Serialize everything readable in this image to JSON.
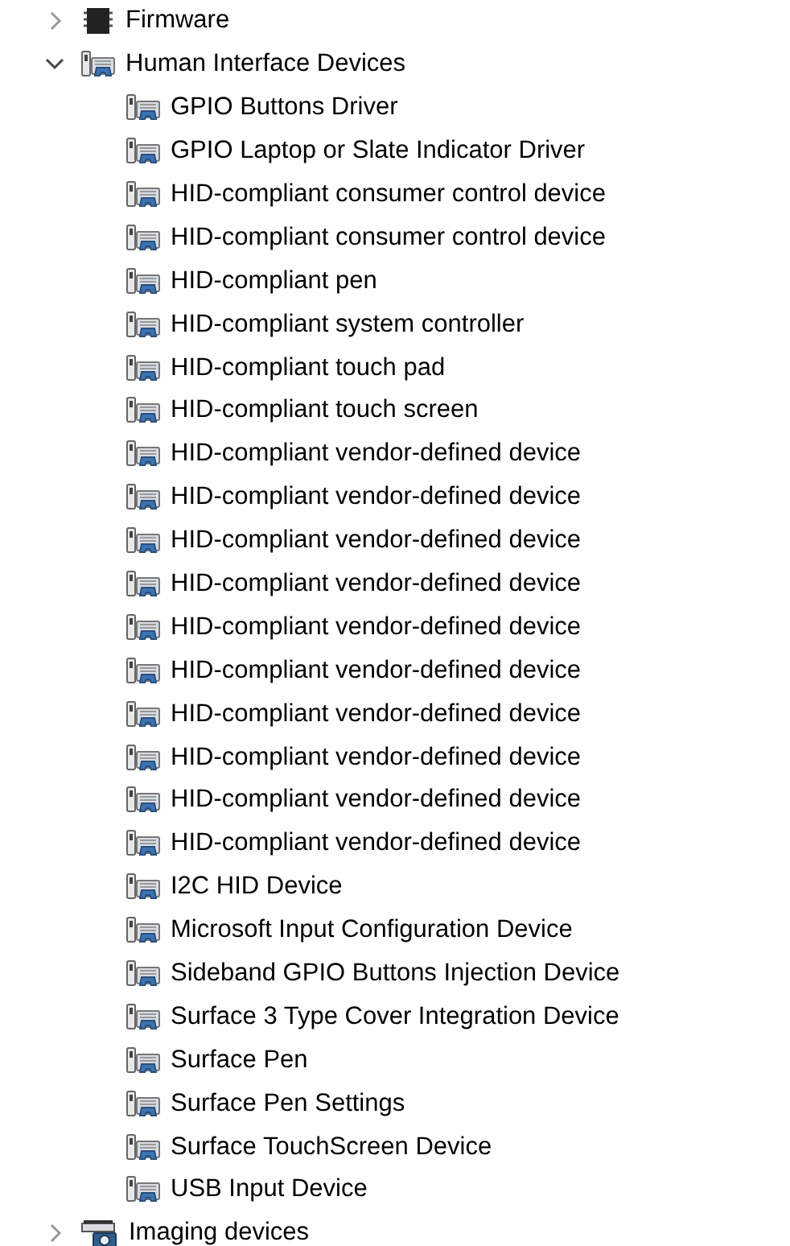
{
  "tree": [
    {
      "label": "Firmware",
      "kind": "firmware",
      "expanded": false
    },
    {
      "label": "Human Interface Devices",
      "kind": "hid",
      "expanded": true,
      "children": [
        {
          "label": "GPIO Buttons Driver"
        },
        {
          "label": "GPIO Laptop or Slate Indicator Driver"
        },
        {
          "label": "HID-compliant consumer control device"
        },
        {
          "label": "HID-compliant consumer control device"
        },
        {
          "label": "HID-compliant pen"
        },
        {
          "label": "HID-compliant system controller"
        },
        {
          "label": "HID-compliant touch pad"
        },
        {
          "label": "HID-compliant touch screen"
        },
        {
          "label": "HID-compliant vendor-defined device"
        },
        {
          "label": "HID-compliant vendor-defined device"
        },
        {
          "label": "HID-compliant vendor-defined device"
        },
        {
          "label": "HID-compliant vendor-defined device"
        },
        {
          "label": "HID-compliant vendor-defined device"
        },
        {
          "label": "HID-compliant vendor-defined device"
        },
        {
          "label": "HID-compliant vendor-defined device"
        },
        {
          "label": "HID-compliant vendor-defined device"
        },
        {
          "label": "HID-compliant vendor-defined device"
        },
        {
          "label": "HID-compliant vendor-defined device"
        },
        {
          "label": "I2C HID Device"
        },
        {
          "label": "Microsoft Input Configuration Device"
        },
        {
          "label": "Sideband GPIO Buttons Injection Device"
        },
        {
          "label": "Surface 3 Type Cover Integration Device"
        },
        {
          "label": "Surface Pen"
        },
        {
          "label": "Surface Pen Settings"
        },
        {
          "label": "Surface TouchScreen Device"
        },
        {
          "label": "USB Input Device"
        }
      ]
    },
    {
      "label": "Imaging devices",
      "kind": "imaging",
      "expanded": false
    }
  ]
}
